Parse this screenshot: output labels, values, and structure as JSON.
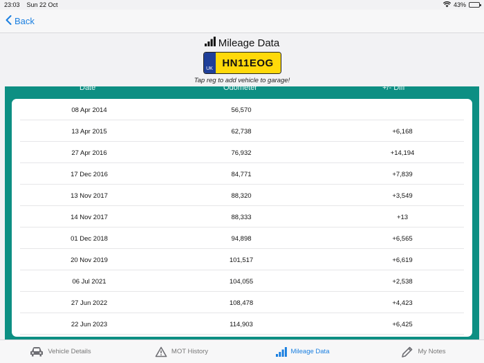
{
  "status": {
    "time": "23:03",
    "date": "Sun 22 Oct",
    "battery": "43%",
    "battery_level": 0.43
  },
  "nav": {
    "back_label": "Back"
  },
  "header": {
    "title": "Mileage Data",
    "plate_country": "UK",
    "plate_reg": "HN11EOG",
    "hint": "Tap reg to add vehicle to garage!"
  },
  "table": {
    "headers": {
      "date": "Date",
      "odometer": "Odometer",
      "diff": "+/- Diff"
    },
    "rows": [
      {
        "date": "08 Apr 2014",
        "odometer": "56,570",
        "diff": ""
      },
      {
        "date": "13 Apr 2015",
        "odometer": "62,738",
        "diff": "+6,168"
      },
      {
        "date": "27 Apr 2016",
        "odometer": "76,932",
        "diff": "+14,194"
      },
      {
        "date": "17 Dec 2016",
        "odometer": "84,771",
        "diff": "+7,839"
      },
      {
        "date": "13 Nov 2017",
        "odometer": "88,320",
        "diff": "+3,549"
      },
      {
        "date": "14 Nov 2017",
        "odometer": "88,333",
        "diff": "+13"
      },
      {
        "date": "01 Dec 2018",
        "odometer": "94,898",
        "diff": "+6,565"
      },
      {
        "date": "20 Nov 2019",
        "odometer": "101,517",
        "diff": "+6,619"
      },
      {
        "date": "06 Jul 2021",
        "odometer": "104,055",
        "diff": "+2,538"
      },
      {
        "date": "27 Jun 2022",
        "odometer": "108,478",
        "diff": "+4,423"
      },
      {
        "date": "22 Jun 2023",
        "odometer": "114,903",
        "diff": "+6,425"
      }
    ]
  },
  "tabs": [
    {
      "label": "Vehicle Details",
      "icon": "car-icon",
      "active": false
    },
    {
      "label": "MOT History",
      "icon": "warning-triangle-icon",
      "active": false
    },
    {
      "label": "Mileage Data",
      "icon": "signal-bars-icon",
      "active": true
    },
    {
      "label": "My Notes",
      "icon": "pencil-icon",
      "active": false
    }
  ],
  "colors": {
    "accent": "#1a7fe0",
    "panel": "#0d8f83",
    "plate_yellow": "#ffd90a",
    "plate_blue": "#1f3f99"
  }
}
